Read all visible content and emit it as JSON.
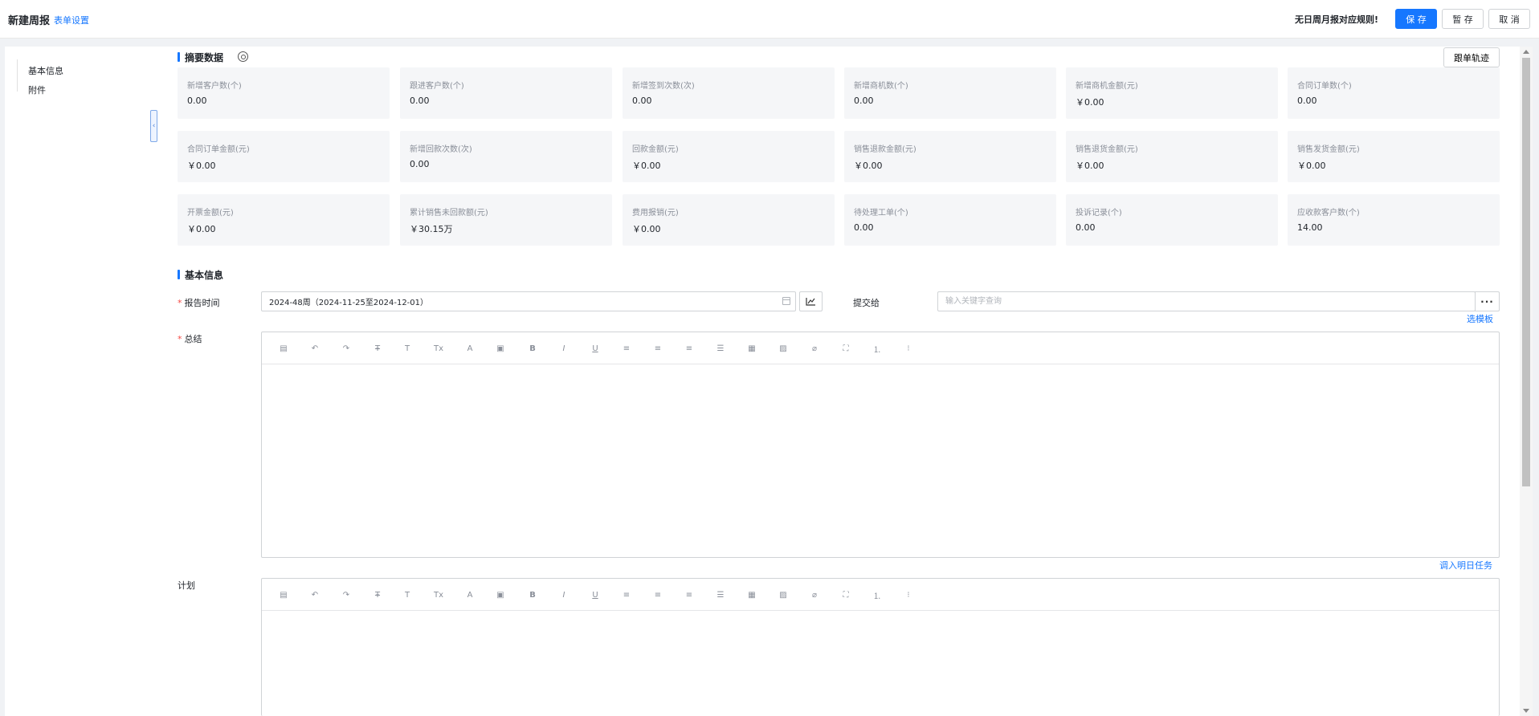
{
  "header": {
    "title": "新建周报",
    "form_settings": "表单设置",
    "warning": "无日周月报对应规则!",
    "save_label": "保 存",
    "draft_label": "暂 存",
    "cancel_label": "取 消"
  },
  "sidebar": {
    "items": [
      {
        "label": "基本信息"
      },
      {
        "label": "附件"
      }
    ]
  },
  "summary": {
    "title": "摘要数据",
    "track_button": "跟单轨迹",
    "cards": [
      {
        "label": "新增客户数(个)",
        "value": "0.00"
      },
      {
        "label": "跟进客户数(个)",
        "value": "0.00"
      },
      {
        "label": "新增签到次数(次)",
        "value": "0.00"
      },
      {
        "label": "新增商机数(个)",
        "value": "0.00"
      },
      {
        "label": "新增商机金额(元)",
        "value": "￥0.00"
      },
      {
        "label": "合同订单数(个)",
        "value": "0.00"
      },
      {
        "label": "合同订单金额(元)",
        "value": "￥0.00"
      },
      {
        "label": "新增回款次数(次)",
        "value": "0.00"
      },
      {
        "label": "回款金额(元)",
        "value": "￥0.00"
      },
      {
        "label": "销售退款金额(元)",
        "value": "￥0.00"
      },
      {
        "label": "销售退货金额(元)",
        "value": "￥0.00"
      },
      {
        "label": "销售发货金额(元)",
        "value": "￥0.00"
      },
      {
        "label": "开票金额(元)",
        "value": "￥0.00"
      },
      {
        "label": "累计销售未回款额(元)",
        "value": "￥30.15万"
      },
      {
        "label": "费用报销(元)",
        "value": "￥0.00"
      },
      {
        "label": "待处理工单(个)",
        "value": "0.00"
      },
      {
        "label": "投诉记录(个)",
        "value": "0.00"
      },
      {
        "label": "应收款客户数(个)",
        "value": "14.00"
      }
    ]
  },
  "basic_info": {
    "title": "基本信息",
    "report_time_label": "报告时间",
    "report_time_value": "2024-48周（2024-11-25至2024-12-01）",
    "submit_to_label": "提交给",
    "submit_to_placeholder": "输入关键字查询",
    "template_link": "选模板",
    "summary_label": "总结",
    "import_tasks_link": "调入明日任务",
    "plan_label": "计划"
  },
  "editor_tools": [
    {
      "name": "template-icon",
      "glyph": "▤"
    },
    {
      "name": "undo-icon",
      "glyph": "↶"
    },
    {
      "name": "redo-icon",
      "glyph": "↷"
    },
    {
      "name": "strikethrough-icon",
      "glyph": "Ŧ"
    },
    {
      "name": "font-size-icon",
      "glyph": "T"
    },
    {
      "name": "clear-format-icon",
      "glyph": "Tx"
    },
    {
      "name": "font-color-icon",
      "glyph": "A"
    },
    {
      "name": "background-color-icon",
      "glyph": "▣"
    },
    {
      "name": "bold-icon",
      "glyph": "B"
    },
    {
      "name": "italic-icon",
      "glyph": "I"
    },
    {
      "name": "underline-icon",
      "glyph": "U"
    },
    {
      "name": "align-left-icon",
      "glyph": "≡"
    },
    {
      "name": "align-center-icon",
      "glyph": "≡"
    },
    {
      "name": "align-right-icon",
      "glyph": "≡"
    },
    {
      "name": "justify-icon",
      "glyph": "☰"
    },
    {
      "name": "table-icon",
      "glyph": "▦"
    },
    {
      "name": "image-icon",
      "glyph": "▨"
    },
    {
      "name": "attachment-icon",
      "glyph": "⌀"
    },
    {
      "name": "fullscreen-icon",
      "glyph": "⛶"
    },
    {
      "name": "ordered-list-icon",
      "glyph": "⒈"
    },
    {
      "name": "bullet-list-icon",
      "glyph": "⁝"
    }
  ],
  "colors": {
    "accent": "#1677ff",
    "required": "#f54a45",
    "card_bg": "#f5f6f8"
  }
}
